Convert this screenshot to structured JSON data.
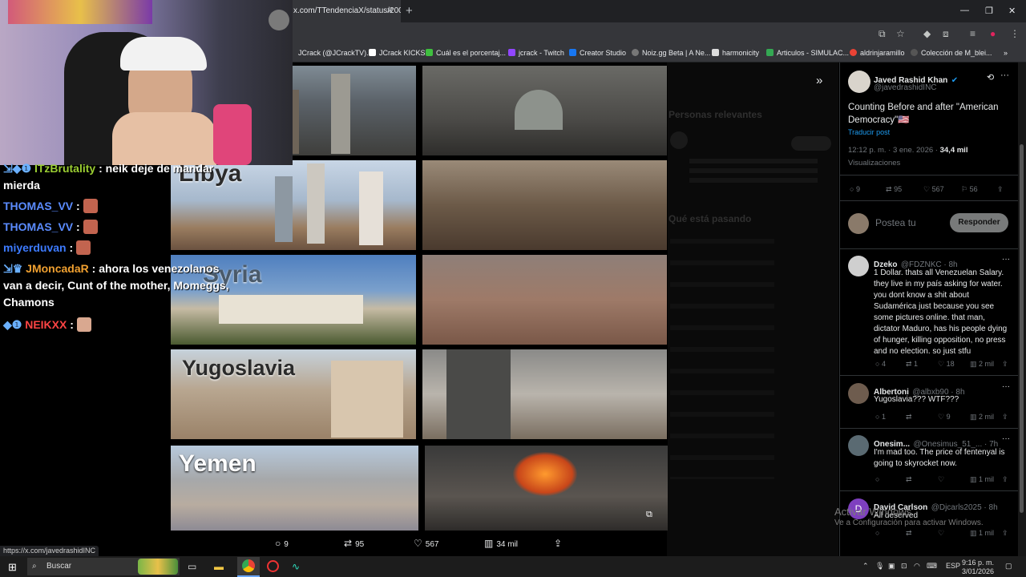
{
  "browser": {
    "tab_title": "x.com/TTendenciaX/status/200",
    "bookmarks": [
      "JCrack (@JCrackTV)...",
      "JCrack KICKS",
      "Cuál es el porcentaj...",
      "jcrack - Twitch",
      "Creator Studio",
      "Noiz.gg Beta | A Ne...",
      "harmonicity",
      "Articulos - SIMULAC...",
      "aldrinjaramillo",
      "Colección de M_blei..."
    ],
    "colors": {
      "accent": "#1d9bf0",
      "chrome": "#35363a"
    }
  },
  "media": {
    "labels": [
      "Libya",
      "Syria",
      "Yugoslavia",
      "Yemen"
    ],
    "actions": {
      "replies": "9",
      "reposts": "95",
      "likes": "567",
      "views": "34 mil"
    }
  },
  "dimmed": {
    "heading_relevant": "Personas relevantes",
    "heading_trending": "Qué está pasando"
  },
  "post": {
    "author_name": "Javed Rashid Khan",
    "author_handle": "@javedrashidINC",
    "text": "Counting Before and after \"American Democracy\"🇺🇸",
    "translate": "Traducir post",
    "time": "12:12 p. m. · 3 ene. 2026 · ",
    "views_count": "34,4 mil",
    "views_label": "Visualizaciones",
    "replies": "9",
    "reposts": "95",
    "likes": "567",
    "bookmarks": "56",
    "reply_placeholder": "Postea tu",
    "reply_button": "Responder"
  },
  "replies": [
    {
      "name": "Dzeko",
      "handle": "@FDZNKC · 8h",
      "text": "1 Dollar. thats all Venezuelan Salary. they live in my país asking for water. you dont know a shit about Sudamérica just because you see some pictures online. that man, dictator Maduro, has his people dying of hunger, killing opposition, no press and no election. so just stfu",
      "replies": "4",
      "reposts": "1",
      "likes": "18",
      "views": "2 mil"
    },
    {
      "name": "Albertoni",
      "handle": "@albxb90 · 8h",
      "text": "Yugoslavia??? WTF???",
      "replies": "1",
      "reposts": "",
      "likes": "9",
      "views": "2 mil"
    },
    {
      "name": "Onesim...",
      "handle": "@Onesimus_51_... · 7h",
      "text": "I'm mad  too. The price of fentenyal is going to skyrocket now.",
      "replies": "",
      "reposts": "",
      "likes": "",
      "views": "1 mil"
    },
    {
      "name": "David Carlson",
      "handle": "@Djcarls2025 · 8h",
      "text": "All deserved",
      "replies": "",
      "reposts": "",
      "likes": "",
      "views": "1 mil",
      "initial": "D"
    }
  ],
  "chat": [
    {
      "user": "ITzBrutality",
      "msg": "neik deje de mandar mierda",
      "color": "#9acd32"
    },
    {
      "user": "THOMAS_VV",
      "msg": "",
      "color": "#5b8cff"
    },
    {
      "user": "THOMAS_VV",
      "msg": "",
      "color": "#5b8cff"
    },
    {
      "user": "miyerduvan",
      "msg": "",
      "color": "#3d7bff"
    },
    {
      "user": "JMoncadaR",
      "msg": "ahora los venezolanos van a decir, Cunt of the mother, Momeggs, Chamons",
      "color": "#f0a030"
    },
    {
      "user": "NEIKXX",
      "msg": "",
      "color": "#ff4444"
    }
  ],
  "status_url": "https://x.com/javedrashidINC",
  "taskbar": {
    "search": "Buscar",
    "lang": "ESP",
    "time": "9:16 p. m.",
    "date": "3/01/2026"
  },
  "watermark": {
    "line1": "Activar Windows",
    "line2": "Ve a Configuración para activar Windows."
  }
}
